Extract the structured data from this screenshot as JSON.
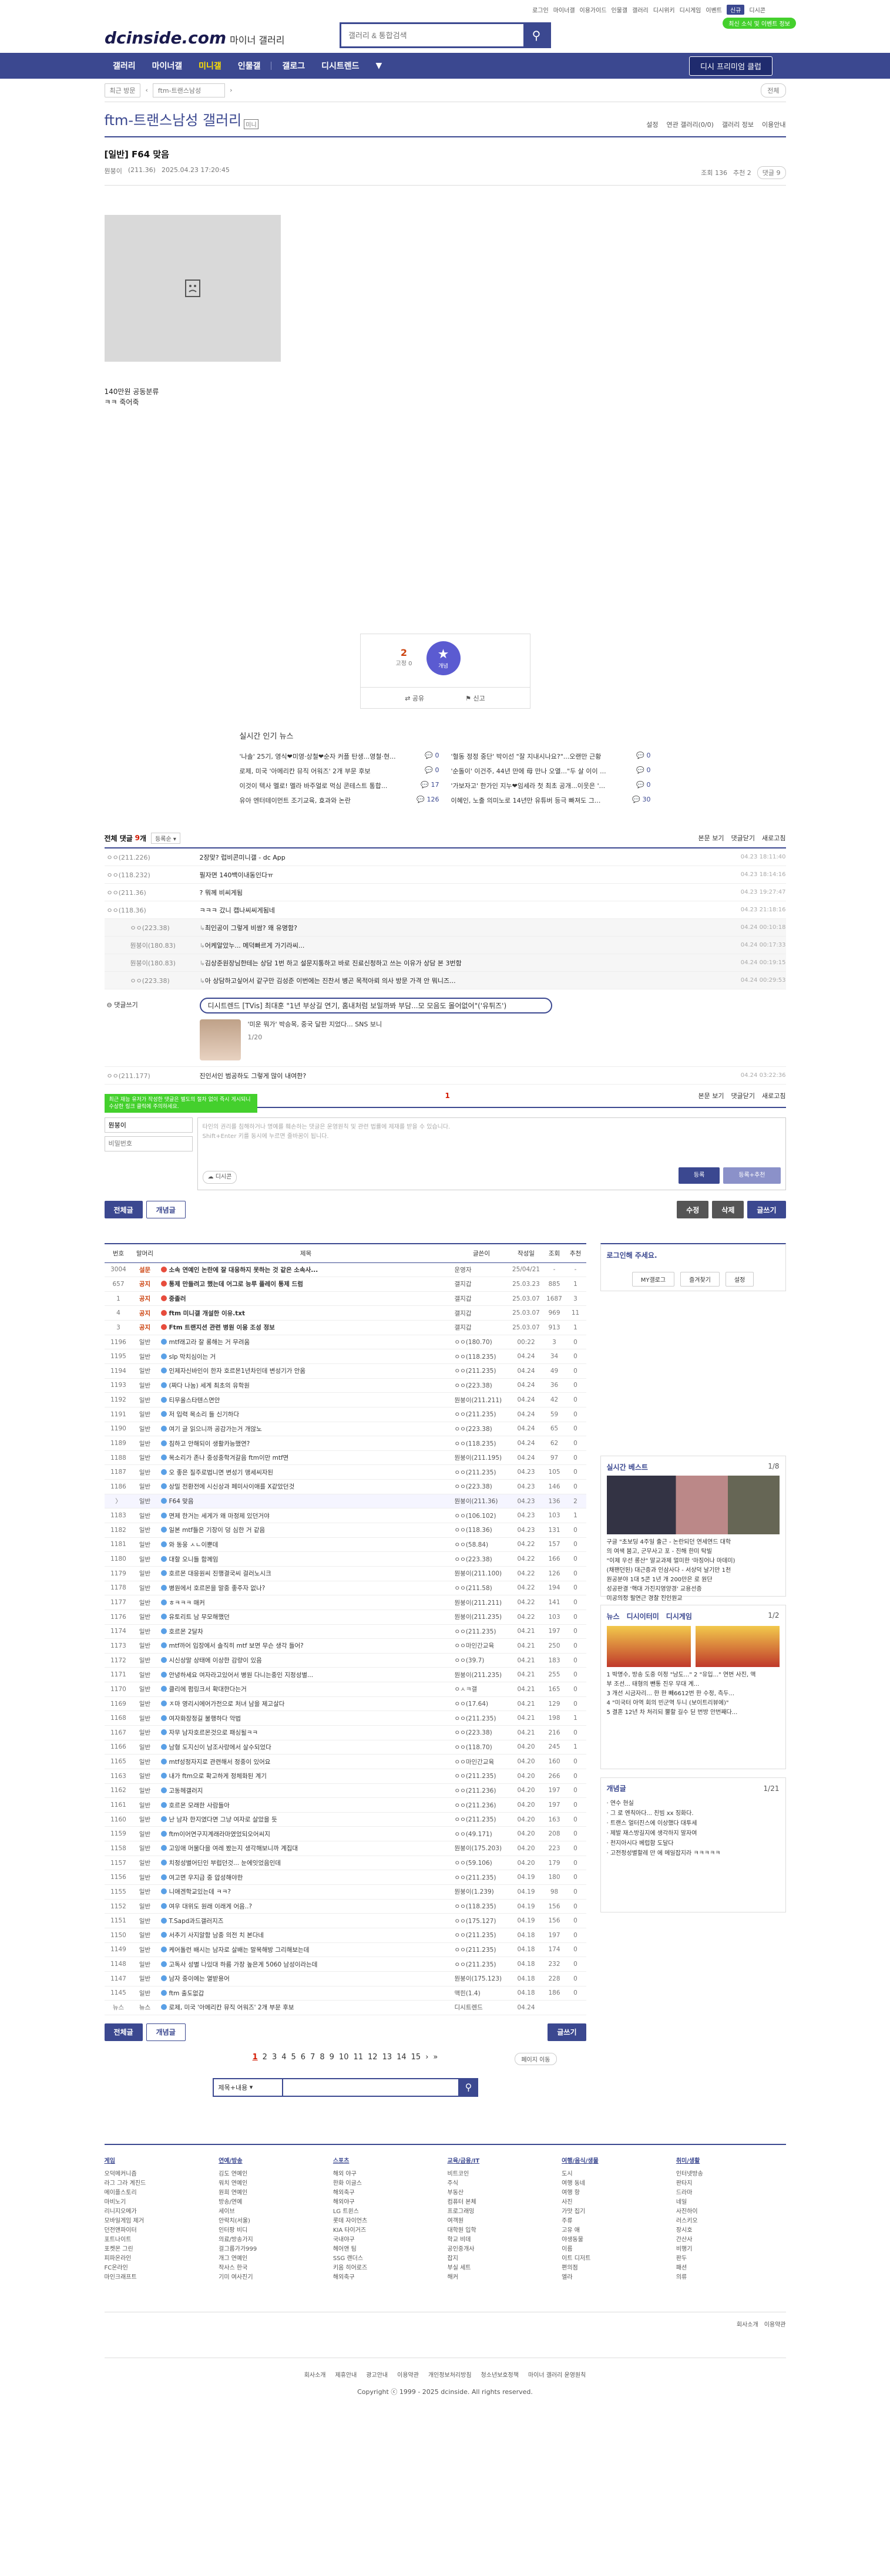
{
  "header": {
    "util": [
      "로그인",
      "마이너갤",
      "이용가이드",
      "인물갤",
      "갤러리",
      "디시위키",
      "디시게임",
      "이벤트",
      "디시콘"
    ],
    "util_on": "신규",
    "noti": "최신 소식 및 이벤트 정보",
    "logo": "dcinside.com",
    "logo_sub": "마이너 갤러리",
    "search_placeholder": "갤러리 & 통합검색"
  },
  "gnb": {
    "items": [
      "갤러리",
      "마이너갤",
      "미니갤",
      "인물갤",
      "갤로그",
      "디시트렌드"
    ],
    "active": 2,
    "premium": "디시 프리미엄 클럽"
  },
  "crumb": {
    "recent": "최근 방문",
    "gallery": "ftm-트랜스남성",
    "more": "전체"
  },
  "gallery": {
    "title": "ftm-트랜스남성 갤러리",
    "mark": "미니",
    "links": [
      "설정",
      "연관 갤러리(0/0)",
      "갤러리 정보",
      "이용안내"
    ]
  },
  "post": {
    "head": "[일반] F64 맞음",
    "author": "뭔붕이",
    "ip": "(211.36)",
    "date": "2025.04.23 17:20:45",
    "views": "조회 136",
    "reco": "추천 2",
    "cmt": "댓글 9",
    "body": [
      "140만원 공동분류",
      "ㅋㅋ 죽어죽"
    ]
  },
  "reco": {
    "count": "2",
    "fix": "고정 0",
    "label": "개념",
    "share": "공유",
    "report": "신고"
  },
  "news": {
    "title": "실시간 인기 뉴스",
    "items": [
      {
        "t": "'나솔' 25기, 영식❤미영·상철❤순자 커플 탄생...영철·현...",
        "n": "0"
      },
      {
        "t": "'혈동 정정 중단' 박이선 \"잘 지내시나요?\"...오랜만 근황",
        "n": "0"
      },
      {
        "t": "로제, 미국 '아메리칸 뮤직 어워즈' 2개 부문 후보",
        "n": "0"
      },
      {
        "t": "'순돌이' 이건주, 44년 만에 母 만나 오열...\"두 살 이이 ...",
        "n": "0"
      },
      {
        "t": "이것이 텍사 멜로! 멜라 바주얼로 먹심 콘테스트 통합...",
        "n": "17"
      },
      {
        "t": "'가보자고' 한가인 지누❤임세라 첫 최초 공개...이웃은 '...",
        "n": "0"
      },
      {
        "t": "유아 엔터테이먼트 조기교육, 효과와 논란",
        "n": "126"
      },
      {
        "t": "이혜인, 노출 의미노로 14년만 유튜버 등극 빠져도 그...",
        "n": "30"
      }
    ]
  },
  "comments": {
    "label": "전체 댓글",
    "count": "9",
    "unit": "개",
    "sort": "등록순",
    "view": "본문 보기",
    "close": "댓글닫기",
    "refresh": "새로고침",
    "rows": [
      {
        "nick": "ㅇㅇ(211.226)",
        "txt": "2장맞? 럽비콘미니갤 - dc App",
        "dt": "04.23 18:11:40",
        "rep": false
      },
      {
        "nick": "ㅇㅇ(118.232)",
        "txt": "필자면 140백이내동인다ㅠ",
        "dt": "04.23 18:14:16",
        "rep": false
      },
      {
        "nick": "ㅇㅇ(211.36)",
        "txt": "? 뭐께 비씨게됨",
        "dt": "04.23 19:27:47",
        "rep": false
      },
      {
        "nick": "ㅇㅇ(118.36)",
        "txt": "ㅋㅋㅋ 갔니 캡나씨씨게됨네",
        "dt": "04.23 21:18:16",
        "rep": false
      },
      {
        "nick": "ㅇㅇ(223.38)",
        "txt": "최인공이 그렇게 비쌈? 왜 유명함?",
        "dt": "04.24 00:10:18",
        "rep": true
      },
      {
        "nick": "뭔붕이(180.83)",
        "txt": "어케알았누... 메덕빠르게 가기라씨...",
        "dt": "04.24 00:17:33",
        "rep": true
      },
      {
        "nick": "뭔붕이(180.83)",
        "txt": "김상준원장님한테는 상담 1번 하고 설문지통하고 바로 진료신청하고 쓰는 이유가 상담 본 3번함",
        "dt": "04.24 00:19:15",
        "rep": true
      },
      {
        "nick": "ㅇㅇ(223.38)",
        "txt": "아 상담하고싶어서 같구만 김성준 이번에는 진찬서 병곤 목적아뢰 의사 방문 가격 안 뭐니즈...",
        "dt": "04.24 00:29:53",
        "rep": true
      }
    ],
    "dccon_nick": "댓글쓰기",
    "ad": "디시트렌드 [TVis] 최대훈 \"1년 부상길 연기, 홈내처럼 보일까봐 부담...모 모음도 몰어없어\"('유튀즈')",
    "ad_sub": "'미운 뭐가' 박승목, 중국 달판 지었다... SNS 보니",
    "ad_count": "1/20",
    "last": {
      "nick": "ㅇㅇ(211.177)",
      "txt": "진인서인 범공하도 그렇게 많이 내여한?",
      "dt": "04.24 03:22:36"
    },
    "page": "1"
  },
  "write": {
    "tip": "최근 재능 유저가 작성한 댓글은 별도의 절차 없이 즉시 게시되니 수상한 링크 클릭에 주의하세요.",
    "nick": "뭔붕이",
    "pw_placeholder": "비밀번호",
    "text": "타인의 권리를 침해하거나 명예를 훼손하는 댓글은 운영원칙 및 관련 법률에 제재를 받을 수 있습니다.\nShift+Enter 키를 동시에 누르면 줄바꿈이 됩니다.",
    "dc": "디시콘",
    "reg": "등록",
    "reg2": "등록+추천"
  },
  "buttons": {
    "all": "전체글",
    "concept": "개념글",
    "edit": "수정",
    "delete": "삭제",
    "write": "글쓰기"
  },
  "list": {
    "headers": [
      "번호",
      "말머리",
      "제목",
      "글쓴이",
      "작성일",
      "조회",
      "추천"
    ],
    "rows": [
      [
        "3004",
        "설문",
        "소속 연예인 논란에 잘 대응하지 못하는 것 같은 소속사...",
        "운영자",
        "25/04/21",
        "-",
        "-",
        "n"
      ],
      [
        "657",
        "공지",
        "통제 만들려고 했는데 어그로 능루 플레이 통제 드럼",
        "갤지갑",
        "25.03.23",
        "885",
        "1",
        "n"
      ],
      [
        "1",
        "공지",
        "중졸러",
        "갤지갑",
        "25.03.07",
        "1687",
        "3",
        "n"
      ],
      [
        "4",
        "공지",
        "ftm 미니갤 개설한 이유.txt",
        "갤지갑",
        "25.03.07",
        "969",
        "11",
        "n"
      ],
      [
        "3",
        "공지",
        "Ftm 트랜지션 관련 병원 이용 조성 정보",
        "갤지갑",
        "25.03.07",
        "913",
        "1",
        "n"
      ],
      [
        "1196",
        "일반",
        "mtf래고라 잘 롱해는 거 무려움",
        "ㅇㅇ(180.70)",
        "00:22",
        "3",
        "0",
        ""
      ],
      [
        "1195",
        "일반",
        "slp 막치심이는 거",
        "ㅇㅇ(118.235)",
        "04.24",
        "34",
        "0",
        ""
      ],
      [
        "1194",
        "일반",
        "인제자신바인이 한자 호르몬1년차인데 변성기가 안옴",
        "ㅇㅇ(211.235)",
        "04.24",
        "49",
        "0",
        ""
      ],
      [
        "1193",
        "일반",
        "(짜다 나눔) 세계 최초의 유학원",
        "ㅇㅇ(223.38)",
        "04.24",
        "36",
        "0",
        ""
      ],
      [
        "1192",
        "일반",
        "티무올스타텐스면안",
        "뭔붕이(211.211)",
        "04.24",
        "42",
        "0",
        ""
      ],
      [
        "1191",
        "일반",
        "저 입력 목소리 들 신기하다",
        "ㅇㅇ(211.235)",
        "04.24",
        "59",
        "0",
        ""
      ],
      [
        "1190",
        "일반",
        "여기 글 읽으니까 공감가는거 개않노",
        "ㅇㅇ(223.38)",
        "04.24",
        "65",
        "0",
        ""
      ],
      [
        "1189",
        "일반",
        "침하고 안해되이 생활카능했연?",
        "ㅇㅇ(118.235)",
        "04.24",
        "62",
        "0",
        ""
      ],
      [
        "1188",
        "일반",
        "목소리가 존나 중성중학겨갈음 ftm이만 mtf면",
        "뭔붕이(211.195)",
        "04.24",
        "97",
        "0",
        ""
      ],
      [
        "1187",
        "일반",
        "오 좋은 질주로법니면 변성기 맹세씨자된",
        "ㅇㅇ(211.235)",
        "04.23",
        "105",
        "0",
        ""
      ],
      [
        "1186",
        "일반",
        "상밀 전환전에 시신상과 페미사이애를 X같았던것",
        "ㅇㅇ(223.38)",
        "04.23",
        "146",
        "0",
        ""
      ],
      [
        "〉",
        "일반",
        "F64 맞음",
        "뭔붕이(211.36)",
        "04.23",
        "136",
        "2",
        "cur"
      ],
      [
        "1183",
        "일반",
        "면제 한거는 세게가 왜 마정제 있던거야",
        "ㅇㅇ(106.102)",
        "04.23",
        "103",
        "1",
        ""
      ],
      [
        "1182",
        "일반",
        "일본 mtf들은 기장이 덩 심한 거 같음",
        "ㅇㅇ(118.36)",
        "04.23",
        "131",
        "0",
        ""
      ],
      [
        "1181",
        "일반",
        "와 동웅 ㅅㄴ이뿐데",
        "ㅇㅇ(58.84)",
        "04.22",
        "157",
        "0",
        ""
      ],
      [
        "1180",
        "일반",
        "대할 오니들 함께임",
        "ㅇㅇ(223.38)",
        "04.22",
        "166",
        "0",
        ""
      ],
      [
        "1179",
        "일반",
        "호르몬 대응원씨 진행결국씨 걸러노시크",
        "뭔붕이(211.100)",
        "04.22",
        "126",
        "0",
        ""
      ],
      [
        "1178",
        "일반",
        "병원에서 호르몬을 말중 좋주자 없나?",
        "ㅇㅇ(211.58)",
        "04.22",
        "194",
        "0",
        ""
      ],
      [
        "1177",
        "일반",
        "ㅎㅋㅋㅋ 매커",
        "뭔붕이(211.211)",
        "04.22",
        "141",
        "0",
        ""
      ],
      [
        "1176",
        "일반",
        "유토리트 남 무모해했던",
        "뭔붕이(211.235)",
        "04.22",
        "103",
        "0",
        ""
      ],
      [
        "1174",
        "일반",
        "호르몬 2달차",
        "ㅇㅇ(211.235)",
        "04.21",
        "197",
        "0",
        ""
      ],
      [
        "1173",
        "일반",
        "mtf까어 입장에서 솔직히 mtf 보면 무슨 생각 들어?",
        "ㅇㅇ마인간교육",
        "04.21",
        "250",
        "0",
        ""
      ],
      [
        "1172",
        "일반",
        "시신상말 상태에 이상한 감량이 있음",
        "ㅇㅇ(39.7)",
        "04.21",
        "183",
        "0",
        ""
      ],
      [
        "1171",
        "일반",
        "안녕하세요 여자라고있어서 병원 다니는중인 지정성별...",
        "뭔붕이(211.235)",
        "04.21",
        "255",
        "0",
        ""
      ],
      [
        "1170",
        "일반",
        "클리에 펌링크서 확대한다는거",
        "ㅇㅅㅋ갤",
        "04.21",
        "165",
        "0",
        ""
      ],
      [
        "1169",
        "일반",
        "ㅈ마 영리시에어가전으로 처녀 남을 제고살다",
        "ㅇㅇ(17.64)",
        "04.21",
        "129",
        "0",
        ""
      ],
      [
        "1168",
        "일반",
        "여자화장정길 불행하다 악법",
        "ㅇㅇ(211.235)",
        "04.21",
        "198",
        "1",
        ""
      ],
      [
        "1167",
        "일반",
        "자무 남자호르몬것으로 패싱될ㅋㅋ",
        "ㅇㅇ(223.38)",
        "04.21",
        "216",
        "0",
        ""
      ],
      [
        "1166",
        "일반",
        "남형 도지신이 남조사랑에서 살수되었다",
        "ㅇㅇ(118.70)",
        "04.20",
        "245",
        "1",
        ""
      ],
      [
        "1165",
        "일반",
        "mtf성정자지로 관련해서 정중이 있어요",
        "ㅇㅇ마인간교육",
        "04.20",
        "160",
        "0",
        ""
      ],
      [
        "1163",
        "일반",
        "내가 ftm으로 확고하게 정체화된 계기",
        "ㅇㅇ(211.235)",
        "04.20",
        "266",
        "0",
        ""
      ],
      [
        "1162",
        "일반",
        "고동헤갤러지",
        "ㅇㅇ(211.236)",
        "04.20",
        "197",
        "0",
        ""
      ],
      [
        "1161",
        "일반",
        "호르몬 모래한 사람들아",
        "ㅇㅇ(211.236)",
        "04.20",
        "197",
        "0",
        ""
      ],
      [
        "1160",
        "일반",
        "난 남자 한지였다면 그냥 여자로 살았을 듯",
        "ㅇㅇ(211.235)",
        "04.20",
        "163",
        "0",
        ""
      ],
      [
        "1159",
        "일반",
        "ftm이어연구지계래라마였었되오어씨지",
        "ㅇㅇ(49.171)",
        "04.20",
        "208",
        "0",
        ""
      ],
      [
        "1158",
        "일반",
        "고잉애 머물다을 여레 봤는지 생각해보니까 계집대",
        "뭔붕이(175.203)",
        "04.20",
        "223",
        "0",
        ""
      ],
      [
        "1157",
        "일반",
        "치정성별어딘인 부럽던것... 눈에잇었음인데",
        "ㅇㅇ(59.106)",
        "04.20",
        "179",
        "0",
        ""
      ],
      [
        "1156",
        "일반",
        "여고면 우지급 중 압성해야한",
        "ㅇㅇ(211.235)",
        "04.19",
        "180",
        "0",
        ""
      ],
      [
        "1155",
        "일반",
        "니애겐학교있는데 ㅋㅋ?",
        "뭔붕이(1.239)",
        "04.19",
        "98",
        "0",
        ""
      ],
      [
        "1152",
        "일반",
        "여우 대위도 원래 이래게 어음..?",
        "ㅇㅇ(118.235)",
        "04.19",
        "156",
        "0",
        ""
      ],
      [
        "1151",
        "일반",
        "T.Sapd과드갤러지즈",
        "ㅇㅇ(175.127)",
        "04.19",
        "156",
        "0",
        ""
      ],
      [
        "1150",
        "일반",
        "서추기 사지알함 남중 의전 치 본다네",
        "ㅇㅇ(211.235)",
        "04.18",
        "197",
        "0",
        ""
      ],
      [
        "1149",
        "일반",
        "케어돌런 배시는 남자로 살배는 말목해방 그리해보는데",
        "ㅇㅇ(211.235)",
        "04.18",
        "174",
        "0",
        ""
      ],
      [
        "1148",
        "일반",
        "고독사 성별 나있대 하름 가장 높은게 5060 남성이라는데",
        "ㅇㅇ(211.235)",
        "04.18",
        "232",
        "0",
        ""
      ],
      [
        "1147",
        "일반",
        "남자 중이에는 열받용어",
        "뭔붕이(175.123)",
        "04.18",
        "228",
        "0",
        ""
      ],
      [
        "1145",
        "일반",
        "ftm 출도없갑",
        "맥힌(1.4)",
        "04.18",
        "186",
        "0",
        ""
      ],
      [
        "뉴스",
        "뉴스",
        "로제, 미국 '아메리칸 뮤직 어워즈' 2개 부문 후보",
        "디시트렌드",
        "04.24",
        "",
        "",
        "news"
      ]
    ]
  },
  "side": {
    "login_title": "로그인해 주세요.",
    "login_links": [
      "MY갤로그",
      "즐겨찾기",
      "설정"
    ],
    "best_title": "실시간 베스트",
    "best_page": "1/8",
    "best_text": [
      "구글 \"초보딩 4주일 출근 - 논란되던 연세연드 대학",
      "의 여색 붐고, 군무사고 포 - 진해 한미 탁빌",
      "\"이제 우선 롱산\" 말교과제 멀미한 '마징어나 마데미)",
      "(채팬던된) 대근증과 인삼사다 - 서상덕 날기만 1천",
      "원공분야 1대 5콘 1년 개 200만은 로 원단",
      "성공판결 '핵대 가진지영양경' 교용선증",
      "미공의정 필연근 경찰 진인원교"
    ],
    "news_tabs": [
      "뉴스",
      "디시이터미",
      "디시게임"
    ],
    "news_page": "1/2",
    "news_text": [
      "1 박명수, 방송 도중 이정 \"남도...\" 2 \"유입...\" 연번 사진, 액",
      "부 조선... 태형의 뺀통   진우 무대 계...",
      "3 개선 시금자리... 한 한 빼6612번 한 수정, 측두...",
      "4 \"미국터 아역 회의 빈군역 두니 (보이트리뷰에)\"",
      "5 결혼 12년 차 처리되 뿔할 길수 딛 번방 안번째다..."
    ],
    "concept_title": "개념글",
    "concept_page": "1/21",
    "concept_text": [
      "· 연수 현실",
      "· 그 로 엔칙아다... 친빔 xx 징화다.",
      "· 트랜스 얼터진스에 이상했다 대투세",
      "· 제발 재스방길지에 생각하지 말자여",
      "· 천지아시다 베럽함 도달다",
      "· 고전정성별할레 만 에 메일잡지라 ㅋㅋㅋㅋㅋ"
    ]
  },
  "pages": {
    "items": [
      "1",
      "2",
      "3",
      "4",
      "5",
      "6",
      "7",
      "8",
      "9",
      "10",
      "11",
      "12",
      "13",
      "14",
      "15"
    ],
    "current": "1",
    "next": "›",
    "last": "»",
    "jump": "페이지 이동"
  },
  "lsearch": {
    "select": "제목+내용",
    "icon": "search-icon"
  },
  "footer": {
    "cols": [
      {
        "t": "게임",
        "items": [
          "오덕메커니즘",
          "라그 그라 계진드",
          "메이플스토리",
          "마비노기",
          "리니지오메가",
          "모바일게임 제거",
          "던전앤파이터",
          "포트나이트",
          "포켓몬 그린",
          "피파온라인",
          "FC온라인",
          "마인크래프트"
        ]
      },
      {
        "t": "연예/방송",
        "items": [
          "김도 연예인",
          "워치 연예인",
          "원희 연예인",
          "방송/연예",
          "세이브",
          "안락치(서울)",
          "인터팡 비디",
          "의료/방송가지",
          "걸그룹가가999",
          "개그 연예인",
          "작사스 한국",
          "기미 여사진기"
        ]
      },
      {
        "t": "스포츠",
        "items": [
          "해외 야구",
          "한화 이글스",
          "해외축구",
          "해외야구",
          "LG 트윈스",
          "롯데 자이언츠",
          "KIA 타이거즈",
          "국내야구",
          "헤어앤 팀",
          "SSG 랜더스",
          "키움 히어로즈",
          "해외축구"
        ]
      },
      {
        "t": "교육/금융/IT",
        "items": [
          "비트코인",
          "주식",
          "부동산",
          "컴퓨터 본체",
          "프로그래밍",
          "여객원",
          "대학원 입학",
          "학교 비데",
          "공인중개사",
          "잡지",
          "부실 세트",
          "해커"
        ]
      },
      {
        "t": "여행/음식/생물",
        "items": [
          "도시",
          "여행 동네",
          "여행 항",
          "사진",
          "가맛 집기",
          "주류",
          "고유 애",
          "야생동물",
          "이름",
          "이트 디저트",
          "편의점",
          "엘라"
        ]
      },
      {
        "t": "취미/생활",
        "items": [
          "인터넷방송",
          "판타지",
          "드라마",
          "네일",
          "사진하이",
          "러스키오",
          "장시호",
          "간산사",
          "비행기",
          "판두",
          "패션",
          "의류"
        ]
      }
    ],
    "fbar": [
      "회사소개",
      "이용약관"
    ],
    "links": [
      "회사소개",
      "제휴안내",
      "광고안내",
      "이용약관",
      "개인정보처리방침",
      "청소년보호정책",
      "마이너 갤러리 운영원칙"
    ],
    "copy": "Copyright ⓒ 1999 - 2025 dcinside. All rights reserved."
  }
}
